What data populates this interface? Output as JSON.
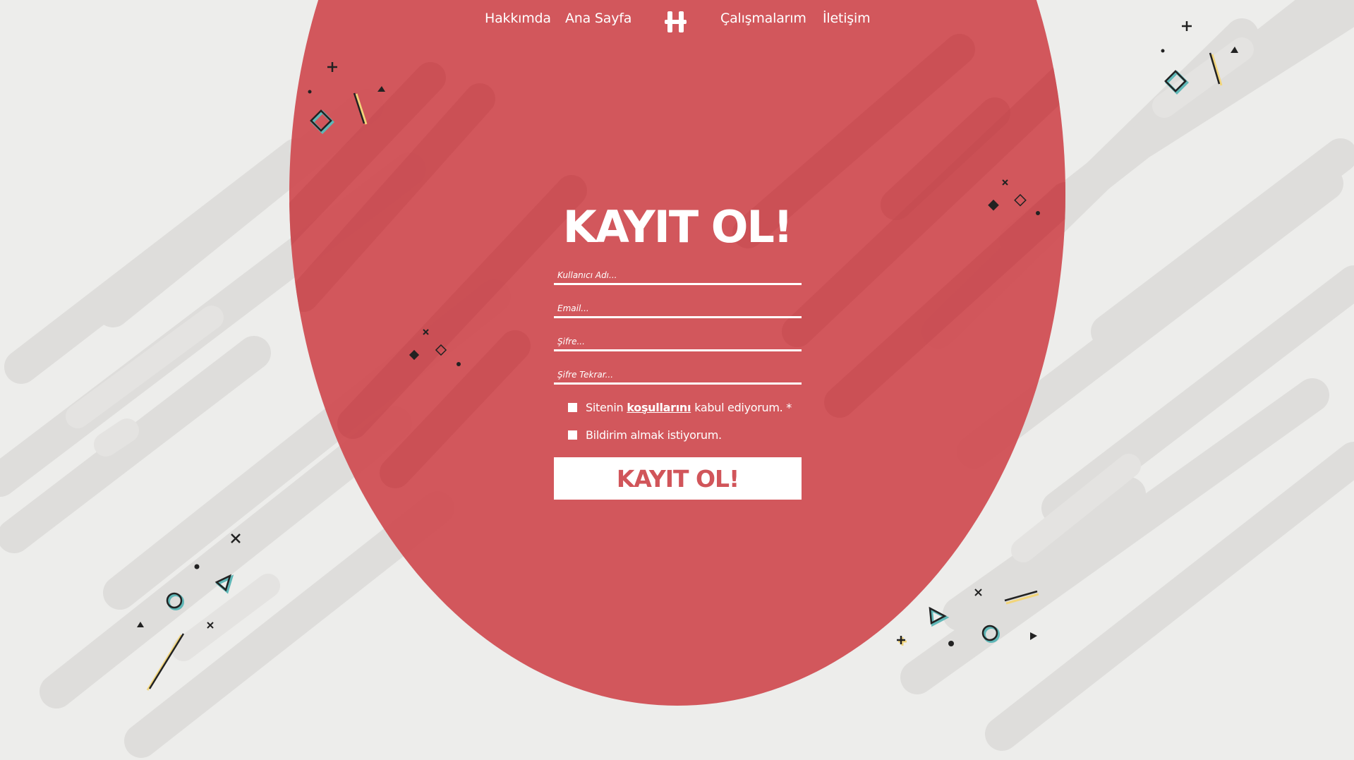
{
  "nav": {
    "about": "Hakkımda",
    "home": "Ana Sayfa",
    "works": "Çalışmalarım",
    "contact": "İletişim",
    "logo_icon": "h-monogram-icon"
  },
  "form": {
    "title": "KAYIT OL!",
    "username_placeholder": "Kullanıcı Adı...",
    "email_placeholder": "Email...",
    "password_placeholder": "Şifre...",
    "password_repeat_placeholder": "Şifre Tekrar...",
    "terms_prefix": "Sitenin",
    "terms_link": "koşullarını",
    "terms_suffix": "kabul ediyorum. *",
    "notify_label": "Bildirim almak istiyorum.",
    "submit_label": "KAYIT OL!"
  },
  "colors": {
    "background": "#ededeb",
    "circle": "#d15257",
    "text": "#ffffff",
    "stripes": "#dcdcda",
    "accent_teal": "#5fb7b7",
    "accent_yellow": "#f2d57a",
    "shape_dark": "#222222"
  }
}
